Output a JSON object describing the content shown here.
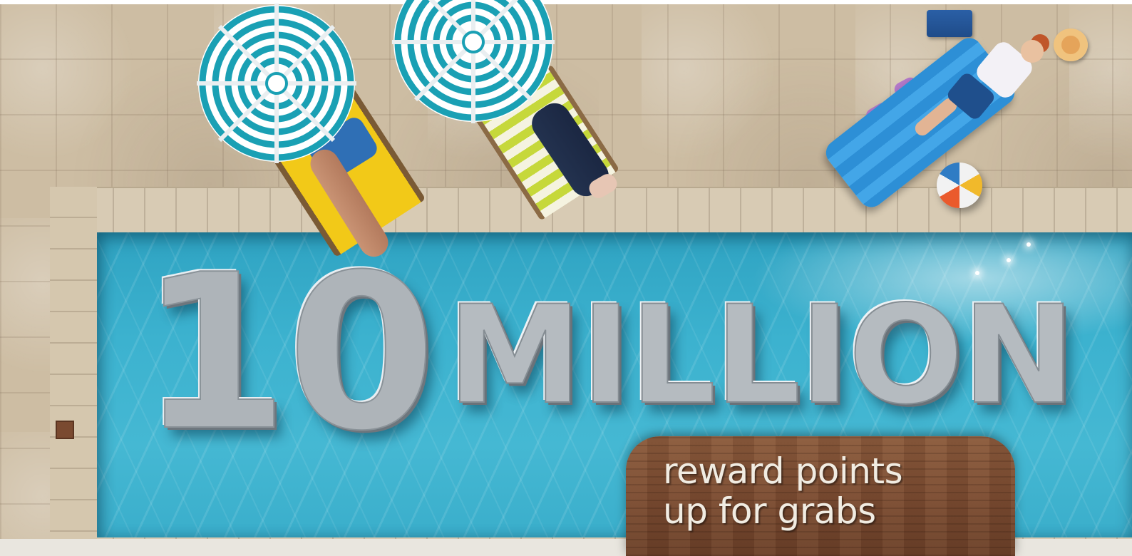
{
  "headline": {
    "number": "10",
    "word": "MILLION"
  },
  "sign": {
    "line1": "reward points",
    "line2": "up for grabs"
  },
  "colors": {
    "pool": "#3cb2cf",
    "deck": "#cdbda3",
    "balloon_silver": "#b5bbc0",
    "sign_wood": "#7a4b31",
    "umbrella_teal": "#1aa0b4"
  },
  "icons": [
    "umbrella-icon",
    "beach-ball-icon",
    "sun-hat-icon",
    "towel-icon",
    "flip-flop-icon"
  ]
}
